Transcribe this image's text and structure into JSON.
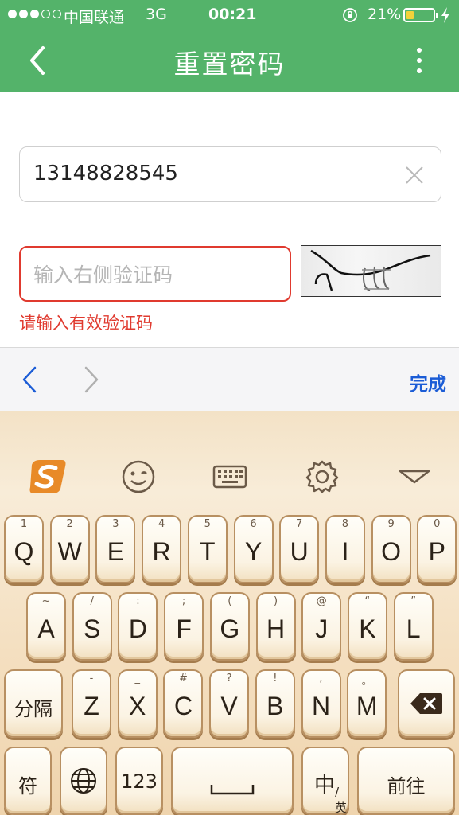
{
  "status": {
    "carrier": "中国联通",
    "network": "3G",
    "time": "00:21",
    "battery_percent": "21%",
    "battery_level": 0.21,
    "signal_bars": 3
  },
  "nav": {
    "title": "重置密码",
    "back_icon": "chevron-left-icon",
    "more_icon": "more-vertical-icon"
  },
  "form": {
    "phone_value": "13148828545",
    "code_placeholder": "输入右侧验证码",
    "code_error": "请输入有效验证码"
  },
  "accessory": {
    "done_label": "完成"
  },
  "keyboard": {
    "row1": [
      {
        "hint": "1",
        "ch": "Q"
      },
      {
        "hint": "2",
        "ch": "W"
      },
      {
        "hint": "3",
        "ch": "E"
      },
      {
        "hint": "4",
        "ch": "R"
      },
      {
        "hint": "5",
        "ch": "T"
      },
      {
        "hint": "6",
        "ch": "Y"
      },
      {
        "hint": "7",
        "ch": "U"
      },
      {
        "hint": "8",
        "ch": "I"
      },
      {
        "hint": "9",
        "ch": "O"
      },
      {
        "hint": "0",
        "ch": "P"
      }
    ],
    "row2": [
      {
        "hint": "~",
        "ch": "A"
      },
      {
        "hint": "/",
        "ch": "S"
      },
      {
        "hint": ":",
        "ch": "D"
      },
      {
        "hint": ";",
        "ch": "F"
      },
      {
        "hint": "(",
        "ch": "G"
      },
      {
        "hint": ")",
        "ch": "H"
      },
      {
        "hint": "@",
        "ch": "J"
      },
      {
        "hint": "“",
        "ch": "K"
      },
      {
        "hint": "”",
        "ch": "L"
      }
    ],
    "row3": [
      {
        "hint": "-",
        "ch": "Z"
      },
      {
        "hint": "_",
        "ch": "X"
      },
      {
        "hint": "#",
        "ch": "C"
      },
      {
        "hint": "?",
        "ch": "V"
      },
      {
        "hint": "!",
        "ch": "B"
      },
      {
        "hint": ",",
        "ch": "N"
      },
      {
        "hint": "。",
        "ch": "M"
      }
    ],
    "separator_label": "分隔",
    "symbol_label": "符",
    "num_label": "123",
    "zhen_main": "中",
    "zhen_sub": "/英",
    "go_label": "前往",
    "accent_color": "#b89062"
  }
}
